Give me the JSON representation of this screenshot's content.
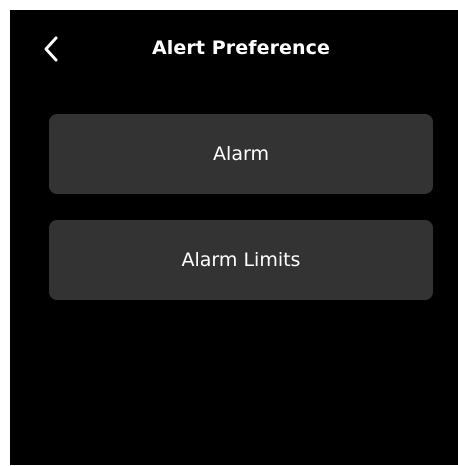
{
  "header": {
    "title": "Alert Preference",
    "back_icon": "chevron-left-icon"
  },
  "menu": {
    "items": [
      {
        "label": "Alarm"
      },
      {
        "label": "Alarm Limits"
      }
    ]
  },
  "colors": {
    "background": "#000000",
    "button_bg": "#333333",
    "text": "#ffffff"
  }
}
